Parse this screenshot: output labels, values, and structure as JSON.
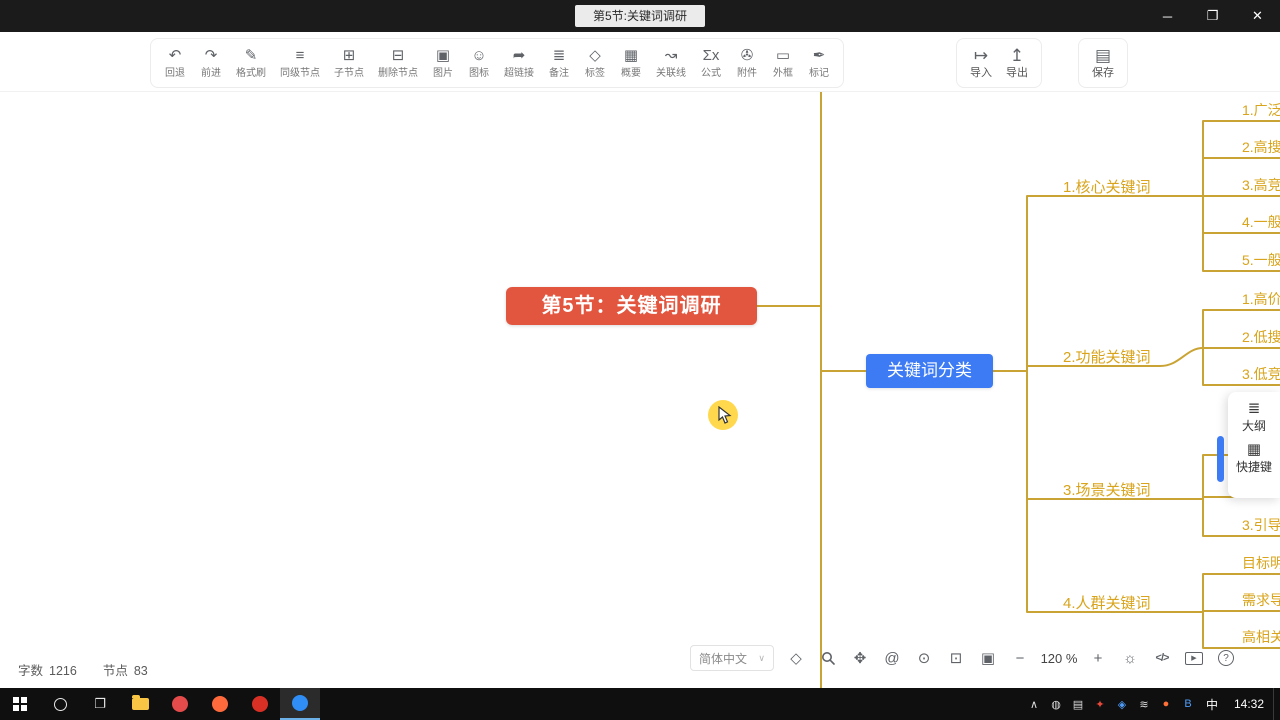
{
  "window": {
    "title": "第5节:关键词调研",
    "minimize_glyph": "─",
    "maximize_glyph": "❐",
    "close_glyph": "✕"
  },
  "toolbar": {
    "items": [
      {
        "label": "回退",
        "glyph": "↶"
      },
      {
        "label": "前进",
        "glyph": "↷"
      },
      {
        "label": "格式刷",
        "glyph": "✎"
      },
      {
        "label": "同级节点",
        "glyph": "≡"
      },
      {
        "label": "子节点",
        "glyph": "⊞"
      },
      {
        "label": "删除节点",
        "glyph": "⊟"
      },
      {
        "label": "图片",
        "glyph": "▣"
      },
      {
        "label": "图标",
        "glyph": "☺"
      },
      {
        "label": "超链接",
        "glyph": "➦"
      },
      {
        "label": "备注",
        "glyph": "≣"
      },
      {
        "label": "标签",
        "glyph": "◇"
      },
      {
        "label": "概要",
        "glyph": "▦"
      },
      {
        "label": "关联线",
        "glyph": "↝"
      },
      {
        "label": "公式",
        "glyph": "Σx"
      },
      {
        "label": "附件",
        "glyph": "✇"
      },
      {
        "label": "外框",
        "glyph": "▭"
      },
      {
        "label": "标记",
        "glyph": "✒"
      }
    ],
    "import_label": "导入",
    "import_glyph": "↦",
    "export_label": "导出",
    "export_glyph": "↥",
    "save_label": "保存",
    "save_glyph": "▤"
  },
  "mindmap": {
    "central": "第5节：关键词调研",
    "category": "关键词分类",
    "branches": [
      "1.核心关键词",
      "2.功能关键词",
      "3.场景关键词",
      "4.人群关键词"
    ],
    "leaves": {
      "core": [
        "1.广泛",
        "2.高搜",
        "3.高竞",
        "4.一般",
        "5.一般"
      ],
      "function": [
        "1.高价",
        "2.低搜",
        "3.低竞"
      ],
      "scene": [
        "3.引导"
      ],
      "audience": [
        "目标明",
        "需求导",
        "高相关"
      ]
    },
    "colors": {
      "central_bg": "#E2563F",
      "category_bg": "#3D7BF5",
      "connector": "#C9A434",
      "branch_text": "#D9A41B"
    }
  },
  "side_panel": {
    "outline_label": "大纲",
    "outline_glyph": "≣",
    "shortcut_label": "快捷键",
    "shortcut_glyph": "▦"
  },
  "statusbar": {
    "word_count_label": "字数",
    "word_count": "1216",
    "node_count_label": "节点",
    "node_count": "83",
    "language": "简体中文",
    "chevron": "∨",
    "zoom_level": "120 %",
    "locate_glyph": "◇",
    "hand_glyph": "✥",
    "mention_glyph": "@",
    "eye_glyph": "⊙",
    "select_glyph": "⊡",
    "frame_glyph": "▣",
    "zoom_out_glyph": "−",
    "zoom_in_glyph": "+",
    "brightness_glyph": "☼",
    "code_glyph": "</>",
    "play_glyph": "▶",
    "help_glyph": "?"
  },
  "taskbar": {
    "tray_glyphs": [
      "∧",
      "◍",
      "▤",
      "✦",
      "◈",
      "≋",
      "●",
      "B"
    ],
    "ime": "中",
    "time": "14:32"
  }
}
